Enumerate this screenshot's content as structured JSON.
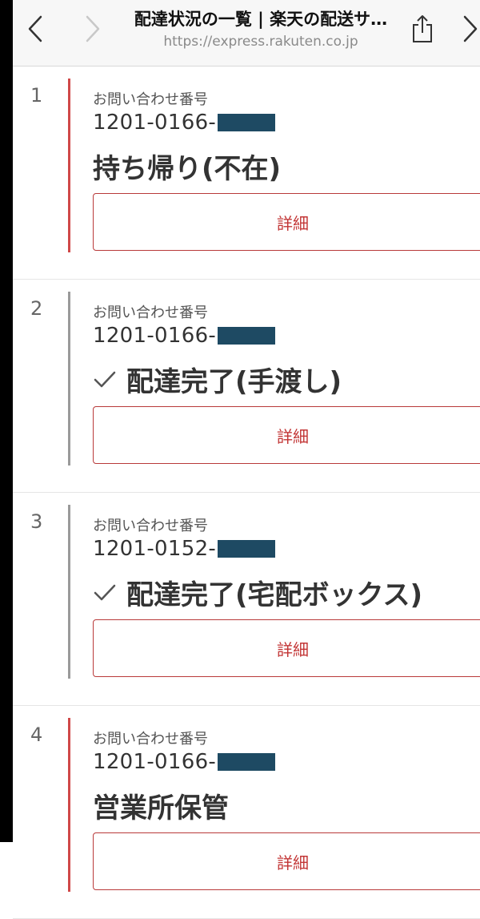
{
  "header": {
    "title": "配達状況の一覧 | 楽天の配送サ…",
    "url": "https://express.rakuten.co.jp"
  },
  "items": [
    {
      "number": "1",
      "label": "お問い合わせ番号",
      "tracking": "1201-0166-",
      "status": "持ち帰り(不在)",
      "checked": false,
      "button": "詳細"
    },
    {
      "number": "2",
      "label": "お問い合わせ番号",
      "tracking": "1201-0166-",
      "status": "配達完了(手渡し)",
      "checked": true,
      "button": "詳細"
    },
    {
      "number": "3",
      "label": "お問い合わせ番号",
      "tracking": "1201-0152-",
      "status": "配達完了(宅配ボックス)",
      "checked": true,
      "button": "詳細"
    },
    {
      "number": "4",
      "label": "お問い合わせ番号",
      "tracking": "1201-0166-",
      "status": "営業所保管",
      "checked": false,
      "button": "詳細"
    }
  ],
  "colors": {
    "accent": "#c23434",
    "bar_red": "#d04848",
    "bar_grey": "#9a9a9a",
    "mask": "#1e4a63"
  }
}
